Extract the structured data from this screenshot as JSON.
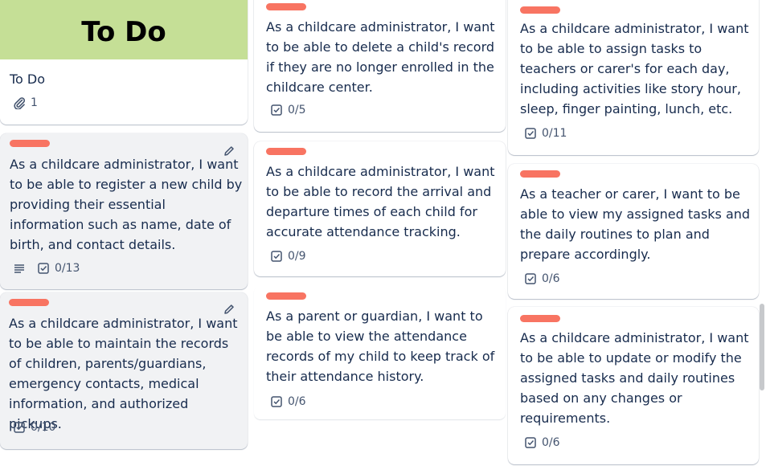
{
  "colors": {
    "label": "#f87462",
    "cover": "#c5df96"
  },
  "columns": [
    {
      "cards": [
        {
          "cover_text": "To Do",
          "title": "To Do",
          "attachments": "1"
        },
        {
          "text": "As a childcare administrator, I want to be able to register a new child by providing their essential information such as name, date of birth, and contact details.",
          "checklist": "0/13",
          "has_description": true
        },
        {
          "text": "As a childcare administrator, I want to be able to maintain the records of children, parents/guardians, emergency contacts, medical information, and authorized pickups.",
          "checklist": "0/10"
        }
      ]
    },
    {
      "cards": [
        {
          "text": "As a childcare administrator, I want to be able to delete a child's record if they are no longer enrolled in the childcare center.",
          "checklist": "0/5"
        },
        {
          "text": "As a childcare administrator, I want to be able to record the arrival and departure times of each child for accurate attendance tracking.",
          "checklist": "0/9"
        },
        {
          "text": "As a parent or guardian, I want to be able to view the attendance records of my child to keep track of their attendance history.",
          "checklist": "0/6"
        }
      ]
    },
    {
      "cards": [
        {
          "text": "As a childcare administrator, I want to be able to assign tasks to teachers or carer's for each day, including activities like story hour, sleep, finger painting, lunch, etc.",
          "checklist": "0/11"
        },
        {
          "text": "As a teacher or carer, I want to be able to view my assigned tasks and the daily routines to plan and prepare accordingly.",
          "checklist": "0/6"
        },
        {
          "text": "As a childcare administrator, I want to be able to update or modify the assigned tasks and daily routines based on any changes or requirements.",
          "checklist": "0/6"
        }
      ]
    }
  ]
}
